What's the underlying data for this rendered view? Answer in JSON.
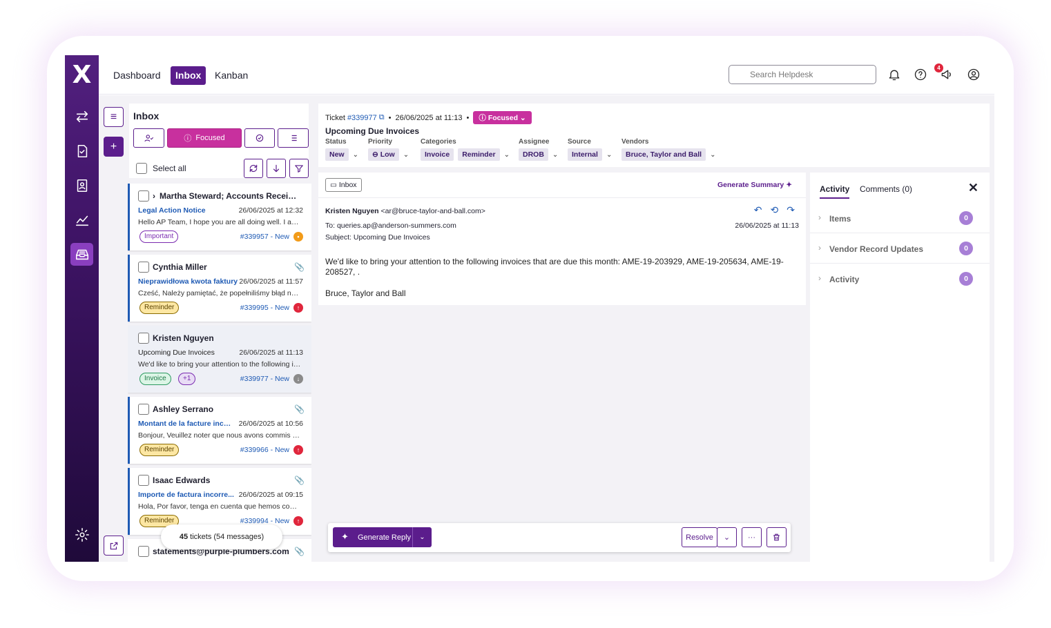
{
  "nav": {
    "items": [
      {
        "label": "Dashboard"
      },
      {
        "label": "Inbox"
      },
      {
        "label": "Kanban"
      }
    ],
    "active": "Inbox"
  },
  "search": {
    "placeholder": "Search Helpdesk"
  },
  "notifications": {
    "badge": "4"
  },
  "inbox": {
    "title": "Inbox",
    "filter_focused": "Focused",
    "select_all": "Select all",
    "tickets": [
      {
        "name": "Martha Steward; Accounts Receiv...",
        "subject": "Legal Action Notice",
        "date": "26/06/2025 at 12:32",
        "preview": "Hello AP Team, I hope you are all doing well. I am f...",
        "tags": [
          "Important"
        ],
        "ref": "#339957 - New"
      },
      {
        "name": "Cynthia Miller",
        "subject": "Nieprawidłowa kwota faktury",
        "date": "26/06/2025 at 11:57",
        "preview": "Cześć, Należy pamiętać, że popełniliśmy błąd na n...",
        "tags": [
          "Reminder"
        ],
        "ref": "#339995 - New"
      },
      {
        "name": "Kristen Nguyen",
        "subject": "Upcoming Due Invoices",
        "date": "26/06/2025 at 11:13",
        "preview": "We'd like to bring your attention to the following in...",
        "tags": [
          "Invoice",
          "+1"
        ],
        "ref": "#339977 - New"
      },
      {
        "name": "Ashley Serrano",
        "subject": "Montant de la facture incor...",
        "date": "26/06/2025 at 10:56",
        "preview": "Bonjour, Veuillez noter que nous avons commis un...",
        "tags": [
          "Reminder"
        ],
        "ref": "#339966 - New"
      },
      {
        "name": "Isaac Edwards",
        "subject": "Importe de factura incorre...",
        "date": "26/06/2025 at 09:15",
        "preview": "Hola, Por favor, tenga en cuenta que hemos come...",
        "tags": [
          "Reminder"
        ],
        "ref": "#339994 - New"
      },
      {
        "name": "statements@purple-plumbers.com"
      }
    ],
    "count_bold": "45",
    "count_rest": " tickets (54 messages)"
  },
  "ticket": {
    "label": "Ticket",
    "id": "#339977",
    "date": "26/06/2025 at 11:13",
    "focus": "Focused",
    "title": "Upcoming Due Invoices",
    "fields": {
      "status_label": "Status",
      "status": "New",
      "priority_label": "Priority",
      "priority": "Low",
      "categories_label": "Categories",
      "categories": [
        "Invoice",
        "Reminder"
      ],
      "assignee_label": "Assignee",
      "assignee": "DROB",
      "source_label": "Source",
      "source": "Internal",
      "vendors_label": "Vendors",
      "vendors": "Bruce, Taylor and Ball"
    }
  },
  "email": {
    "folder": "Inbox",
    "generate_summary": "Generate Summary",
    "from_name": "Kristen Nguyen",
    "from_addr": "<ar@bruce-taylor-and-ball.com>",
    "to_label": "To:",
    "to": "queries.ap@anderson-summers.com",
    "subject_label": "Subject:",
    "subject": "Upcoming Due Invoices",
    "date": "26/06/2025 at 11:13",
    "body": "We'd like to bring your attention to the following invoices that are due this month: AME-19-203929, AME-19-205634, AME-19-208527, .",
    "signature": "Bruce, Taylor and Ball"
  },
  "reply": {
    "generate": "Generate Reply",
    "resolve": "Resolve",
    "more": "···"
  },
  "side": {
    "tab_activity": "Activity",
    "tab_comments": "Comments (0)",
    "sections": [
      {
        "label": "Items",
        "count": "0"
      },
      {
        "label": "Vendor Record Updates",
        "count": "0"
      },
      {
        "label": "Activity",
        "count": "0"
      }
    ]
  },
  "colors": {
    "brand": "#5b1d8c",
    "focus": "#c8309e",
    "link": "#1e5ab4"
  }
}
